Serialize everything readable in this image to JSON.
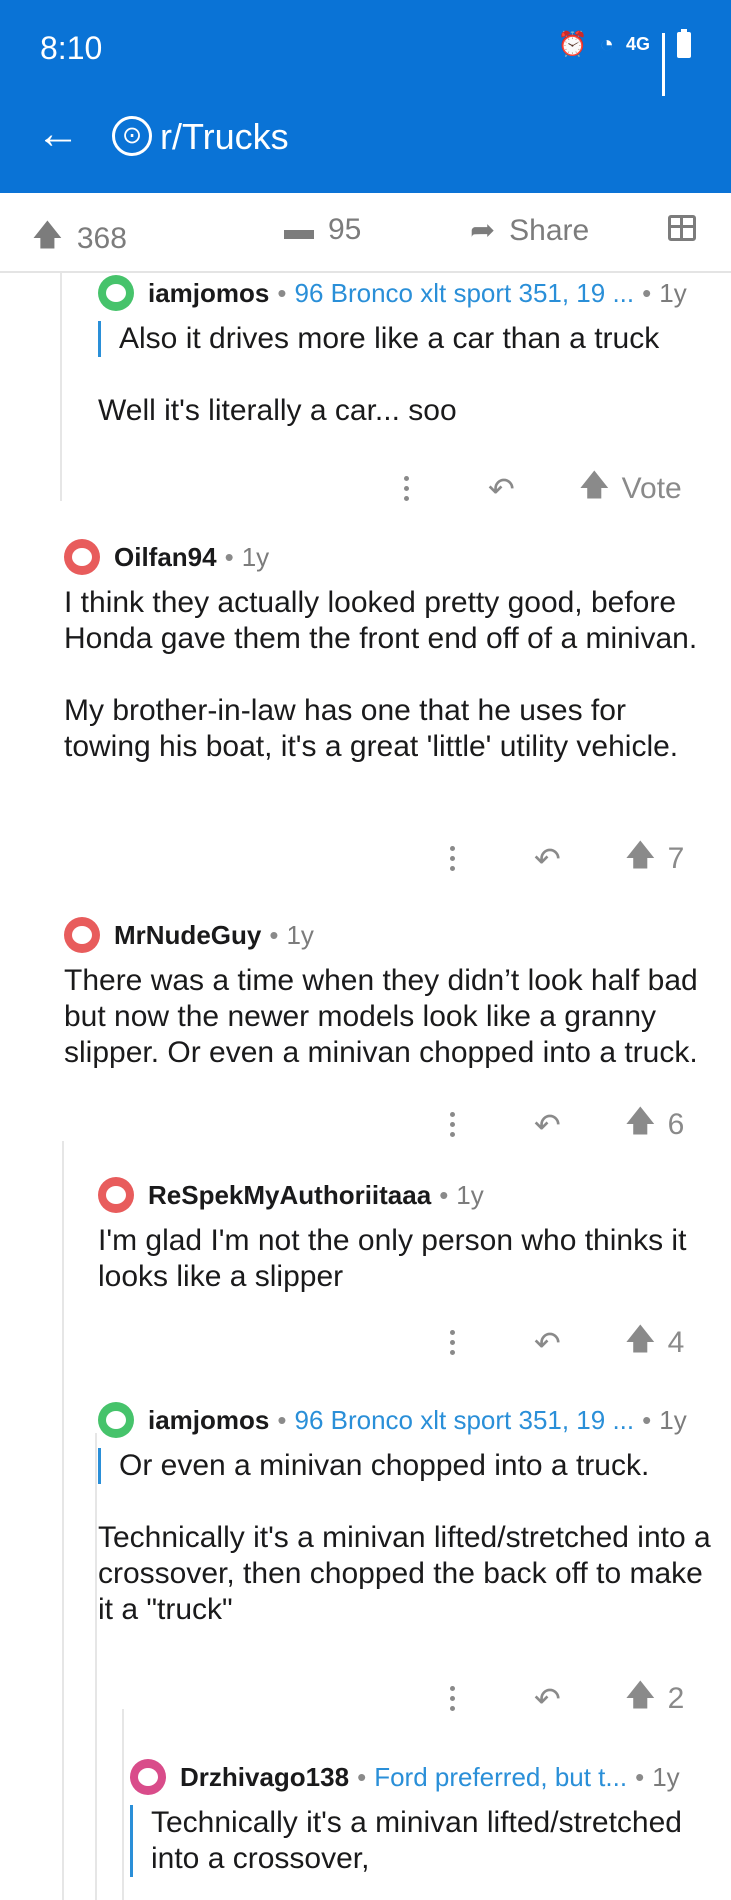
{
  "status_bar": {
    "time": "8:10",
    "network": "4G"
  },
  "header": {
    "subreddit": "r/Trucks"
  },
  "post_actions": {
    "votes": "368",
    "comments": "95",
    "share": "Share"
  },
  "comments": [
    {
      "author": "iamjomos",
      "flair": "96 Bronco xlt sport 351, 19 ...",
      "age": "1y",
      "quote": "Also it drives more like a car than a truck",
      "body": [
        "Well it's literally a car... soo"
      ],
      "score": "Vote",
      "avatar_color": "#46c36b"
    },
    {
      "author": "Oilfan94",
      "flair": "",
      "age": "1y",
      "quote": "",
      "body": [
        "I think they actually looked pretty good, before Honda gave them the front end off of a minivan.",
        "My brother-in-law has one that he uses for towing his boat, it's a great 'little' utility vehicle."
      ],
      "score": "7",
      "avatar_color": "#e85c5c"
    },
    {
      "author": "MrNudeGuy",
      "flair": "",
      "age": "1y",
      "quote": "",
      "body": [
        "There was a time when they didn’t look half bad but now the newer models look like a granny slipper. Or even a minivan chopped into a truck."
      ],
      "score": "6",
      "avatar_color": "#e85c5c"
    },
    {
      "author": "ReSpekMyAuthoriitaaa",
      "flair": "",
      "age": "1y",
      "quote": "",
      "body": [
        "I'm glad I'm not the only person who thinks it looks like a slipper"
      ],
      "score": "4",
      "avatar_color": "#e85c5c"
    },
    {
      "author": "iamjomos",
      "flair": "96 Bronco xlt sport 351, 19 ...",
      "age": "1y",
      "quote": "Or even a minivan chopped into a truck.",
      "body": [
        "Technically it's a minivan lifted/stretched into a crossover, then chopped the back off to make it a \"truck\""
      ],
      "score": "2",
      "avatar_color": "#46c36b"
    },
    {
      "author": "Drzhivago138",
      "flair": "Ford preferred, but t...",
      "age": "1y",
      "quote": "Technically it's a minivan lifted/stretched into a crossover,",
      "body": [],
      "score": "",
      "avatar_color": "#d94c8a"
    }
  ]
}
